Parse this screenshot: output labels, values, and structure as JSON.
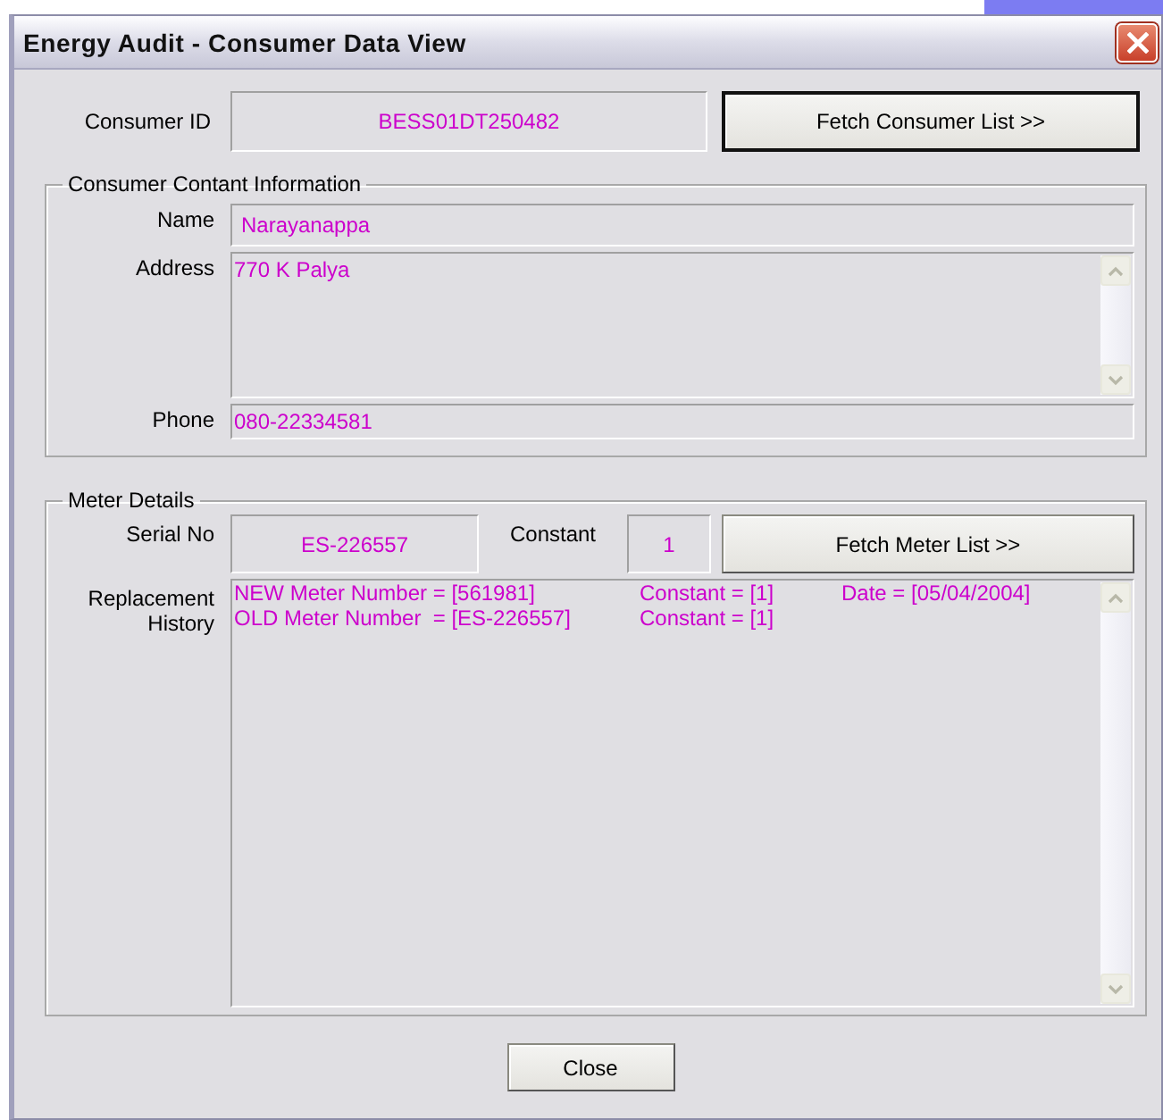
{
  "window": {
    "title": "Energy Audit - Consumer Data View"
  },
  "consumer": {
    "label": "Consumer ID",
    "value": "BESS01DT250482",
    "button": {
      "label": "Fetch Consumer List >>",
      "default": true
    }
  },
  "contact": {
    "title": "Consumer Contant Information",
    "fields": [
      {
        "kind": "line",
        "label": "Name",
        "value": "Narayanappa"
      },
      {
        "kind": "memo",
        "label": "Address",
        "value": "770 K Palya"
      },
      {
        "kind": "line",
        "label": "Phone",
        "value": "080-22334581"
      }
    ]
  },
  "meter": {
    "title": "Meter Details",
    "serial": {
      "label": "Serial No",
      "value": "ES-226557"
    },
    "constant": {
      "label": "Constant",
      "value": "1"
    },
    "button": {
      "label": "Fetch Meter List >>",
      "default": false
    },
    "history": {
      "label": "Replacement History",
      "lines": [
        {
          "meter": "NEW Meter Number = [561981]",
          "constant": "Constant = [1]",
          "date": "Date = [05/04/2004]"
        },
        {
          "meter": "OLD Meter Number  = [ES-226557]",
          "constant": "Constant = [1]"
        }
      ]
    }
  },
  "close_button": {
    "label": "Close",
    "default": false
  }
}
